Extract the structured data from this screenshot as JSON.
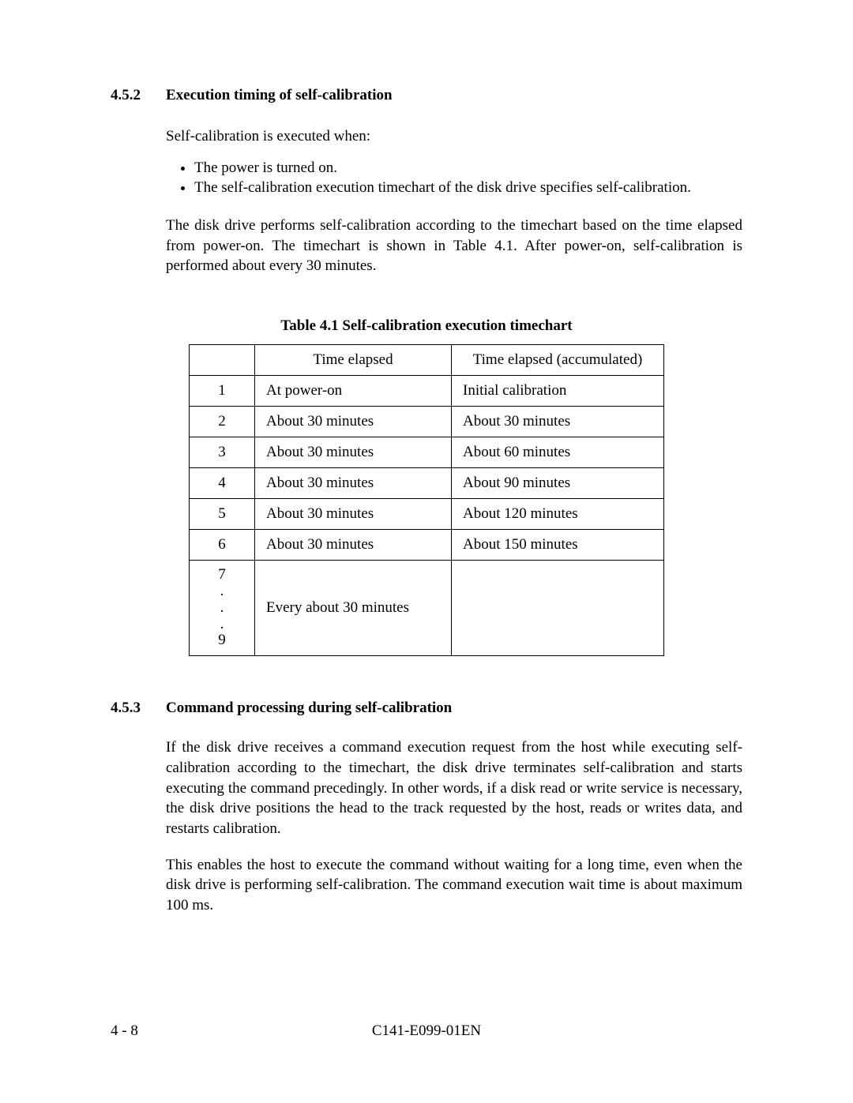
{
  "section_452": {
    "number": "4.5.2",
    "title": "Execution timing of self-calibration",
    "intro": "Self-calibration is executed when:",
    "bullets": [
      "The power is turned on.",
      "The self-calibration execution timechart of the disk drive specifies self-calibration."
    ],
    "desc": "The disk drive performs self-calibration according to the timechart based on the time elapsed from power-on.  The timechart is shown in Table 4.1.  After power-on, self-calibration is performed about every 30 minutes."
  },
  "table": {
    "caption": "Table 4.1    Self-calibration execution timechart",
    "head_idx": "",
    "head_elapsed": "Time elapsed",
    "head_acc": "Time elapsed (accumulated)",
    "rows": [
      {
        "idx": "1",
        "elapsed": "At power-on",
        "acc": "Initial calibration"
      },
      {
        "idx": "2",
        "elapsed": "About 30 minutes",
        "acc": "About 30 minutes"
      },
      {
        "idx": "3",
        "elapsed": "About 30 minutes",
        "acc": "About 60 minutes"
      },
      {
        "idx": "4",
        "elapsed": "About 30 minutes",
        "acc": "About 90 minutes"
      },
      {
        "idx": "5",
        "elapsed": "About 30 minutes",
        "acc": "About 120 minutes"
      },
      {
        "idx": "6",
        "elapsed": "About 30 minutes",
        "acc": "About 150 minutes"
      }
    ],
    "last_row": {
      "idx_top": "7",
      "idx_dots": ".\n.\n.",
      "idx_bottom": "9",
      "elapsed": "Every about 30 minutes",
      "acc": ""
    }
  },
  "section_453": {
    "number": "4.5.3",
    "title": "Command processing during self-calibration",
    "p1": "If the disk drive receives a command execution request from the host while executing self-calibration according to the timechart, the disk drive terminates self-calibration and starts executing the command precedingly.  In other words, if a disk read or write service is necessary, the disk drive positions the head to the track requested by the host, reads or writes data, and restarts calibration.",
    "p2": "This enables the host to execute the command without waiting for a long time, even when the disk drive is performing self-calibration.  The command execution wait time is about maximum 100 ms."
  },
  "footer": {
    "page": "4 - 8",
    "doc_id": "C141-E099-01EN"
  }
}
